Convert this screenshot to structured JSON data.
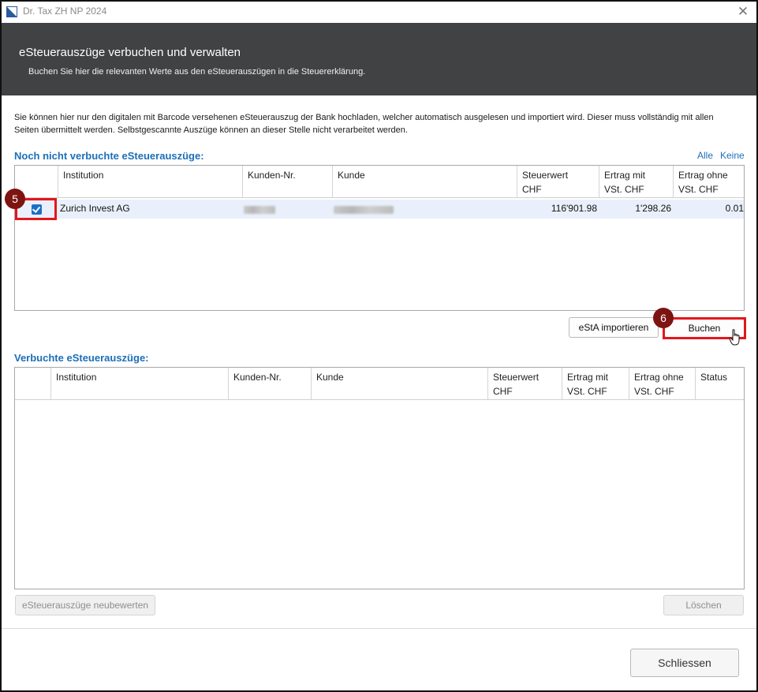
{
  "window": {
    "title": "Dr. Tax ZH NP 2024"
  },
  "header": {
    "title": "eSteuerauszüge verbuchen und verwalten",
    "subtitle": "Buchen Sie hier die relevanten Werte aus den eSteuerauszügen in die Steuererklärung."
  },
  "intro": {
    "text": "Sie können hier nur den digitalen mit Barcode versehenen eSteuerauszug der Bank hochladen, welcher automatisch ausgelesen und importiert wird. Dieser muss vollständig mit allen Seiten übermittelt werden. Selbstgescannte Auszüge können an dieser Stelle nicht verarbeitet werden."
  },
  "unbooked": {
    "title": "Noch nicht verbuchte eSteuerauszüge:",
    "select_all": "Alle",
    "select_none": "Keine",
    "columns": [
      "Institution",
      "Kunden-Nr.",
      "Kunde",
      "Steuerwert\nCHF",
      "Ertrag mit\nVSt. CHF",
      "Ertrag ohne\nVSt. CHF"
    ],
    "rows": [
      {
        "checked": true,
        "institution": "Zurich Invest AG",
        "steuerwert": "116'901.98",
        "ertrag_mit": "1'298.26",
        "ertrag_ohne": "0.01"
      }
    ],
    "import_button": "eStA importieren",
    "book_button": "Buchen"
  },
  "booked": {
    "title": "Verbuchte eSteuerauszüge:",
    "columns": [
      "Institution",
      "Kunden-Nr.",
      "Kunde",
      "Steuerwert\nCHF",
      "Ertrag mit\nVSt. CHF",
      "Ertrag ohne\nVSt. CHF",
      "Status"
    ],
    "rows": [],
    "reassess_button": "eSteuerauszüge neubewerten",
    "delete_button": "Löschen"
  },
  "footer": {
    "close_button": "Schliessen"
  },
  "markers": {
    "step5": "5",
    "step6": "6"
  },
  "colors": {
    "accent": "#1d6fb8",
    "header_bg": "#414244",
    "highlight": "#e3161c",
    "badge": "#7d1412"
  }
}
